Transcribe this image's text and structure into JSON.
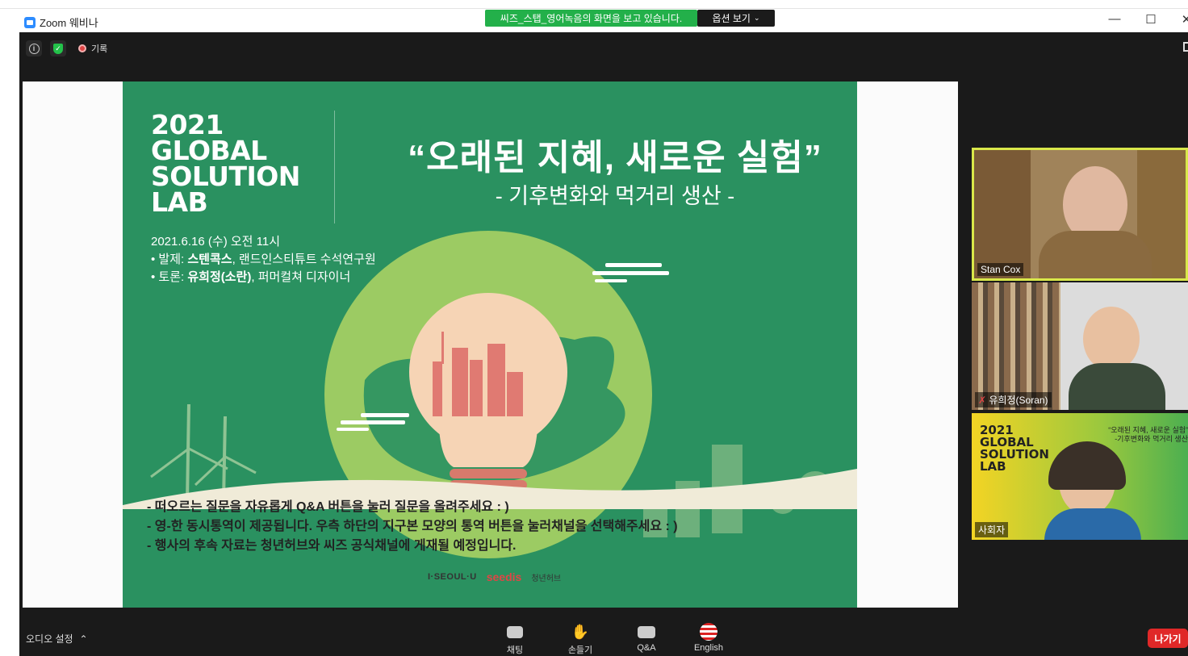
{
  "window": {
    "app_title": "Zoom 웨비나",
    "share_banner": "씨즈_스탭_영어녹음의 화면을 보고 있습니다.",
    "view_options": "옵션 보기",
    "controls": {
      "minimize": "—",
      "maximize": "☐",
      "close": "✕"
    }
  },
  "topbar": {
    "record_label": "기록"
  },
  "slide": {
    "year_title": [
      "2021",
      "GLOBAL",
      "SOLUTION",
      "LAB"
    ],
    "main_title": "“오래된 지혜, 새로운 실험”",
    "sub_title": "- 기후변화와 먹거리 생산 -",
    "date": "2021.6.16 (수) 오전 11시",
    "presenter_label": "• 발제: ",
    "presenter_name": "스텐콕스",
    "presenter_role": ", 랜드인스티튜트 수석연구원",
    "discussant_label": "• 토론: ",
    "discussant_name": "유희정(소란)",
    "discussant_role": ", 퍼머컬쳐 디자이너",
    "notes": [
      "-  떠오르는 질문을 자유롭게 Q&A 버튼을 눌러 질문을 올려주세요 : )",
      "-  영-한 동시통역이 제공됩니다. 우측 하단의 지구본 모양의 통역 버튼을 눌러채널을 선택해주세요 : )",
      "-  행사의 후속 자료는 청년허브와 씨즈 공식채널에 게재될 예정입니다."
    ],
    "logos": {
      "seoul": "I·SEOUL·U",
      "seedis": "seedis",
      "hub": "청년허브"
    }
  },
  "participants": [
    {
      "name": "Stan Cox"
    },
    {
      "name": "유희정(Soran)"
    },
    {
      "name": "사회자"
    }
  ],
  "host_tile": {
    "title": [
      "2021",
      "GLOBAL",
      "SOLUTION",
      "LAB"
    ],
    "line1": "“오래된 지혜, 새로운 실험”",
    "line2": "-기후변화와 먹거리 생산"
  },
  "toolbar": {
    "audio_settings": "오디오 설정",
    "chat": "채팅",
    "raise_hand": "손들기",
    "qa": "Q&A",
    "language": "English",
    "leave": "나가기"
  },
  "colors": {
    "slide_green": "#2a9160",
    "share_banner_green": "#23b04a",
    "active_speaker_border": "#d9e84a",
    "leave_red": "#e02828"
  }
}
